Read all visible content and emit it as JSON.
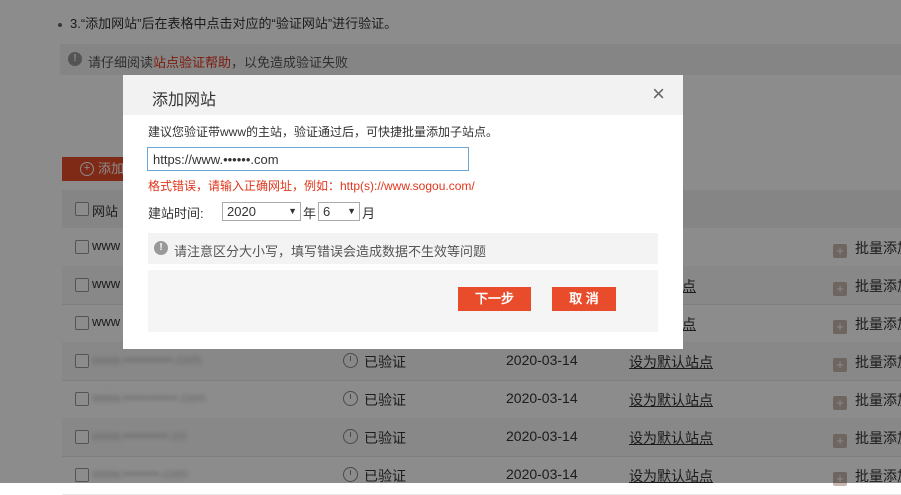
{
  "page": {
    "step3": "3.“添加网站”后在表格中点击对应的“验证网站”进行验证。",
    "tip_prefix": "请仔细阅读",
    "tip_link": "站点验证帮助",
    "tip_suffix": "，以免造成验证失败",
    "add_button": "添加",
    "header_site": "网站",
    "rows": [
      {
        "site": "www"
      },
      {
        "site": "www"
      },
      {
        "site": "www"
      },
      {
        "site": "www.•••••••••••.com",
        "status": "已验证",
        "date": "2020-03-14",
        "action": "设为默认站点"
      },
      {
        "site": "www.••••••••••••.com",
        "status": "已验证",
        "date": "2020-03-14",
        "action": "设为默认站点"
      },
      {
        "site": "www.••••••••••.cn",
        "status": "已验证",
        "date": "2020-03-14",
        "action": "设为默认站点"
      },
      {
        "site": "www.••••••••.com",
        "status": "已验证",
        "date": "2020-03-14",
        "action": "设为默认站点"
      }
    ],
    "partial_action": "点",
    "batch_label": "批量添加"
  },
  "modal": {
    "title": "添加网站",
    "close": "×",
    "hint": "建议您验证带www的主站，验证通过后，可快捷批量添加子站点。",
    "url_value": "https://www.••••••.com",
    "error": "格式错误，请输入正确网址，例如：http(s)://www.sogou.com/",
    "date_label": "建站时间:",
    "year": "2020",
    "year_unit": "年",
    "month": "6",
    "month_unit": "月",
    "notice": "请注意区分大小写，填写错误会造成数据不生效等问题",
    "next": "下一步",
    "cancel": "取 消"
  },
  "colors": {
    "accent": "#e84c2b",
    "link": "#e0361c",
    "overlay": "rgba(0,0,0,0.45)"
  },
  "icons": {
    "info": "info-icon",
    "clock": "clock-icon",
    "plus": "plus-icon",
    "close": "close-icon"
  }
}
